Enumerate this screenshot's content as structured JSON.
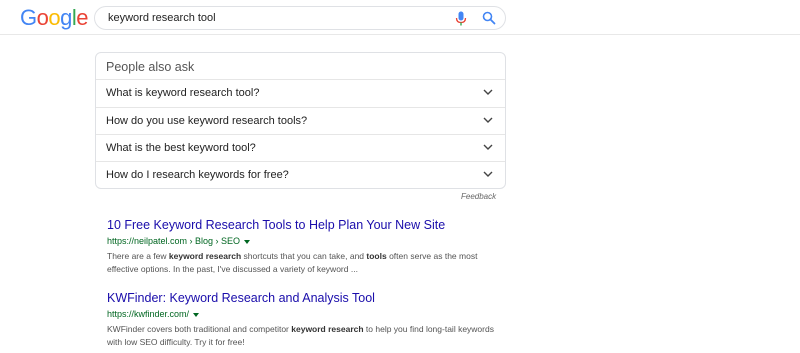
{
  "header": {
    "logo": "Google",
    "search_query": "keyword research tool"
  },
  "paa": {
    "title": "People also ask",
    "questions": [
      "What is keyword research tool?",
      "How do you use keyword research tools?",
      "What is the best keyword tool?",
      "How do I research keywords for free?"
    ],
    "feedback": "Feedback"
  },
  "results": [
    {
      "title": "10 Free Keyword Research Tools to Help Plan Your New Site",
      "url": "https://neilpatel.com › Blog › SEO",
      "snippet_parts": [
        "There are a few ",
        "keyword research",
        " shortcuts that you can take, and ",
        "tools",
        " often serve as the most effective options. In the past, I've discussed a variety of keyword ..."
      ]
    },
    {
      "title": "KWFinder: Keyword Research and Analysis Tool",
      "url": "https://kwfinder.com/",
      "snippet_parts": [
        "KWFinder covers both traditional and competitor ",
        "keyword research",
        " to help you find long-tail keywords with low SEO difficulty. Try it for free!"
      ]
    }
  ],
  "colors": {
    "link": "#1a0dab",
    "url": "#006621",
    "logo_blue": "#4285F4",
    "logo_red": "#EA4335",
    "logo_yellow": "#FBBC05",
    "logo_green": "#34A853"
  },
  "icons": {
    "mic": "microphone-icon",
    "search": "search-icon",
    "expand": "chevron-down-icon",
    "url_menu": "caret-down-icon"
  }
}
